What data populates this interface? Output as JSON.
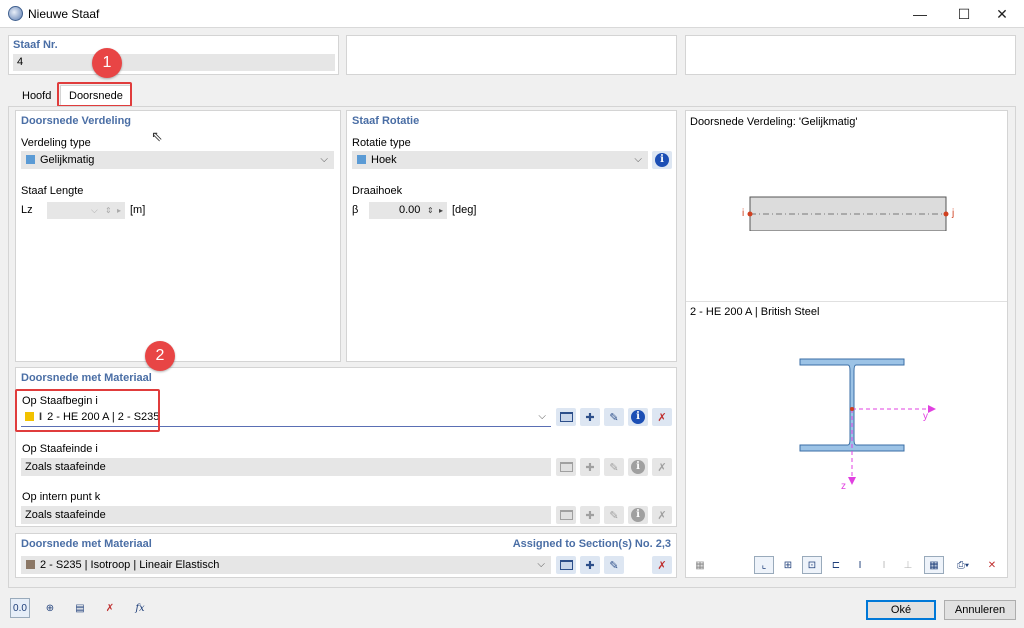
{
  "window": {
    "title": "Nieuwe Staaf",
    "minimize": "—",
    "maximize": "☐",
    "close": "✕"
  },
  "header": {
    "staaf_nr_label": "Staaf Nr.",
    "staaf_nr_value": "4"
  },
  "tabs": [
    {
      "label": "Hoofd"
    },
    {
      "label": "Doorsnede"
    }
  ],
  "callouts": {
    "one": "1",
    "two": "2"
  },
  "distribution": {
    "group_title": "Doorsnede Verdeling",
    "type_label": "Verdeling type",
    "type_value": "Gelijkmatig",
    "length_label": "Staaf Lengte",
    "lz_symbol": "Lz",
    "lz_unit": "[m]"
  },
  "rotation": {
    "group_title": "Staaf Rotatie",
    "type_label": "Rotatie type",
    "type_value": "Hoek",
    "angle_label": "Draaihoek",
    "beta_symbol": "β",
    "beta_value": "0.00",
    "beta_unit": "[deg]"
  },
  "section_material": {
    "group_title": "Doorsnede met Materiaal",
    "start_label": "Op Staafbegin i",
    "start_value": "2 - HE 200 A | 2 - S235",
    "end_label": "Op Staafeinde i",
    "end_value": "Zoals staafeinde",
    "internal_label": "Op intern punt k",
    "internal_value": "Zoals staafeinde"
  },
  "material_bottom": {
    "group_title": "Doorsnede met Materiaal",
    "assigned": "Assigned to Section(s) No. 2,3",
    "value": "2 - S235 | Isotroop | Lineair Elastisch"
  },
  "preview": {
    "distribution_title": "Doorsnede Verdeling: 'Gelijkmatig'",
    "node_i": "i",
    "node_j": "j",
    "section_title": "2 - HE 200 A | British Steel",
    "axis_y": "y",
    "axis_z": "z"
  },
  "footer": {
    "ok": "Oké",
    "cancel": "Annuleren"
  },
  "colors": {
    "accent": "#4a6ea5",
    "callout": "#e03c3c",
    "swatch_blue": "#5b9bd5",
    "swatch_yellow": "#f2c200",
    "swatch_brown": "#8b7765",
    "section_fill": "#9cc3e6",
    "axis_magenta": "#e040e0"
  }
}
